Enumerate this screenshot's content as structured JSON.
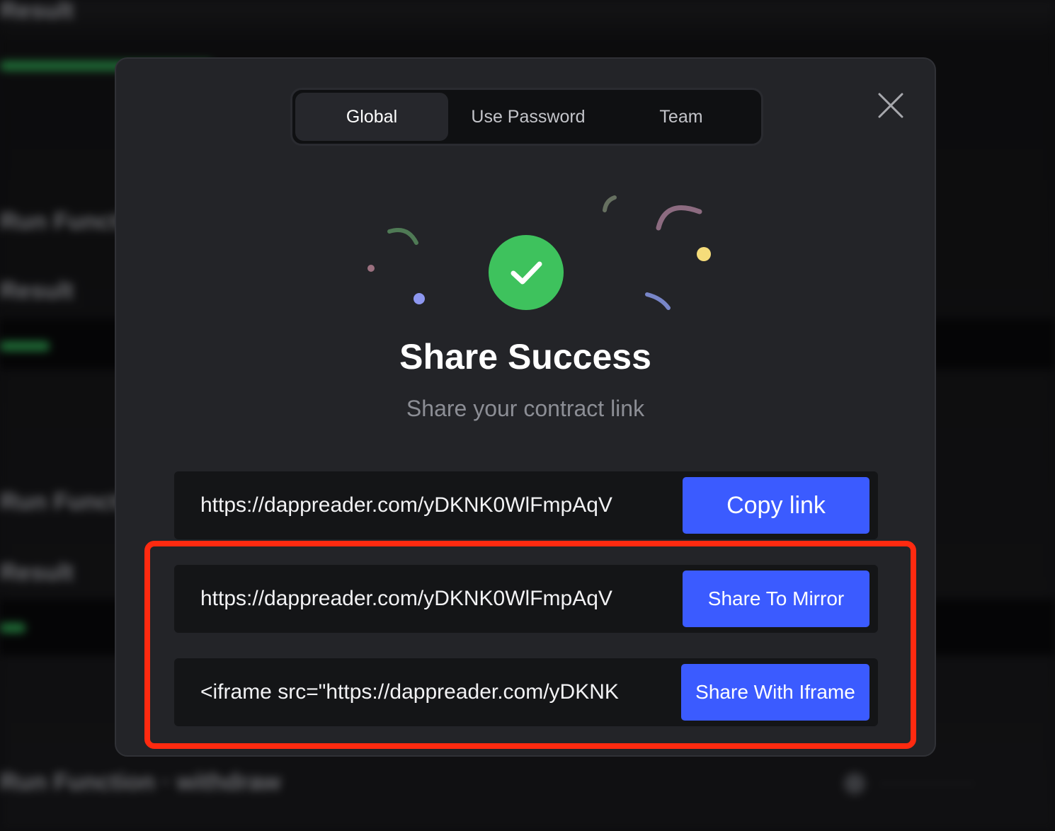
{
  "modal": {
    "tabs": [
      {
        "label": "Global",
        "active": true
      },
      {
        "label": "Use Password",
        "active": false
      },
      {
        "label": "Team",
        "active": false
      }
    ],
    "close_icon": "close-x-icon",
    "success_icon": "check-circle-icon",
    "title": "Share Success",
    "subtitle": "Share your contract link",
    "rows": [
      {
        "value": "https://dappreader.com/yDKNK0WlFmpAqV",
        "button": "Copy link"
      },
      {
        "value": "https://dappreader.com/yDKNK0WlFmpAqV",
        "button": "Share To Mirror"
      },
      {
        "value": "<iframe src=\"https://dappreader.com/yDKNK",
        "button": "Share With Iframe"
      }
    ]
  },
  "colors": {
    "accent_button": "#3b5bff",
    "success_green": "#3ec25d",
    "highlight_red": "#ff2a10",
    "modal_bg": "#232428"
  }
}
